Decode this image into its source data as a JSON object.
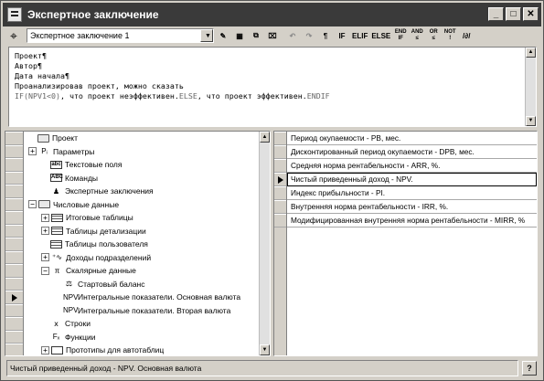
{
  "window": {
    "title": "Экспертное заключение",
    "buttons": {
      "minimize": "_",
      "maximize": "□",
      "close": "✕"
    }
  },
  "toolbar": {
    "combo_value": "Экспертное заключение 1",
    "buttons": {
      "undo": "↶",
      "redo": "↷",
      "paragraph": "¶",
      "if": "IF",
      "elif": "ELIF",
      "else": "ELSE",
      "endif": [
        "END",
        "IF"
      ],
      "and": [
        "AND",
        "≤"
      ],
      "or": [
        "OR",
        "≤"
      ],
      "not": [
        "NOT",
        "!"
      ],
      "formula": "/∂/"
    }
  },
  "editor": {
    "lines": [
      {
        "text": "Проект¶",
        "grey": false
      },
      {
        "text": "Автор¶",
        "grey": false
      },
      {
        "text": "Дата начала¶",
        "grey": false
      },
      {
        "text": "Проанализировав проект, можно сказать",
        "grey": false
      }
    ],
    "condition": {
      "if_kw": "IF(NPV1<0)",
      "part1": ", что проект неэффективен.",
      "else_kw": "ELSE",
      "part2": ", что проект эффективен.",
      "endif_kw": "ENDIF"
    }
  },
  "tree": {
    "items": [
      {
        "label": "Проект",
        "indent": 0,
        "pm": "",
        "icon": "folder-icon",
        "glyph": ""
      },
      {
        "label": "Параметры",
        "indent": 0,
        "pm": "+",
        "icon": "parameters-icon",
        "glyph": "Pᵢ"
      },
      {
        "label": "Текстовые поля",
        "indent": 1,
        "pm": "",
        "icon": "text-field-icon",
        "glyph": "abc"
      },
      {
        "label": "Команды",
        "indent": 1,
        "pm": "",
        "icon": "commands-icon",
        "glyph": "ABC"
      },
      {
        "label": "Экспертные заключения",
        "indent": 1,
        "pm": "",
        "icon": "expert-icon",
        "glyph": "♟"
      },
      {
        "label": "Числовые данные",
        "indent": 0,
        "pm": "−",
        "icon": "folder-icon",
        "glyph": ""
      },
      {
        "label": "Итоговые таблицы",
        "indent": 1,
        "pm": "+",
        "icon": "table-icon",
        "glyph": ""
      },
      {
        "label": "Таблицы детализации",
        "indent": 1,
        "pm": "+",
        "icon": "detail-table-icon",
        "glyph": ""
      },
      {
        "label": "Таблицы пользователя",
        "indent": 1,
        "pm": "",
        "icon": "user-table-icon",
        "glyph": ""
      },
      {
        "label": "Доходы подразделений",
        "indent": 1,
        "pm": "+",
        "icon": "division-income-icon",
        "glyph": "⁺∿"
      },
      {
        "label": "Скалярные данные",
        "indent": 1,
        "pm": "−",
        "icon": "pi-icon",
        "glyph": "π"
      },
      {
        "label": "Стартовый баланс",
        "indent": 2,
        "pm": "",
        "icon": "balance-icon",
        "glyph": "⚖"
      },
      {
        "label": "Интегральные показатели. Основная валюта",
        "indent": 2,
        "pm": "",
        "icon": "npv-icon",
        "glyph": "NPV"
      },
      {
        "label": "Интегральные показатели. Вторая валюта",
        "indent": 2,
        "pm": "",
        "icon": "npv-icon",
        "glyph": "NPV"
      },
      {
        "label": "Строки",
        "indent": 1,
        "pm": "",
        "icon": "strings-icon",
        "glyph": "ⅹ"
      },
      {
        "label": "Функции",
        "indent": 1,
        "pm": "",
        "icon": "functions-icon",
        "glyph": "Fₓ"
      },
      {
        "label": "Прототипы для автотаблиц",
        "indent": 1,
        "pm": "+",
        "icon": "prototype-icon",
        "glyph": ""
      }
    ],
    "current_row": 12
  },
  "list": {
    "items": [
      "Период окупаемости - PB, мес.",
      "Дисконтированный период окупаемости - DPB, мес.",
      "Средняя норма рентабельности - ARR, %.",
      "Чистый приведенный доход - NPV.",
      "Индекс прибыльности - PI.",
      "Внутренняя норма рентабельности - IRR, %.",
      "Модифицированная внутренняя норма рентабельности - MIRR, %"
    ],
    "selected": 3
  },
  "status": {
    "text": "Чистый приведенный доход - NPV. Основная валюта",
    "help": "?"
  }
}
